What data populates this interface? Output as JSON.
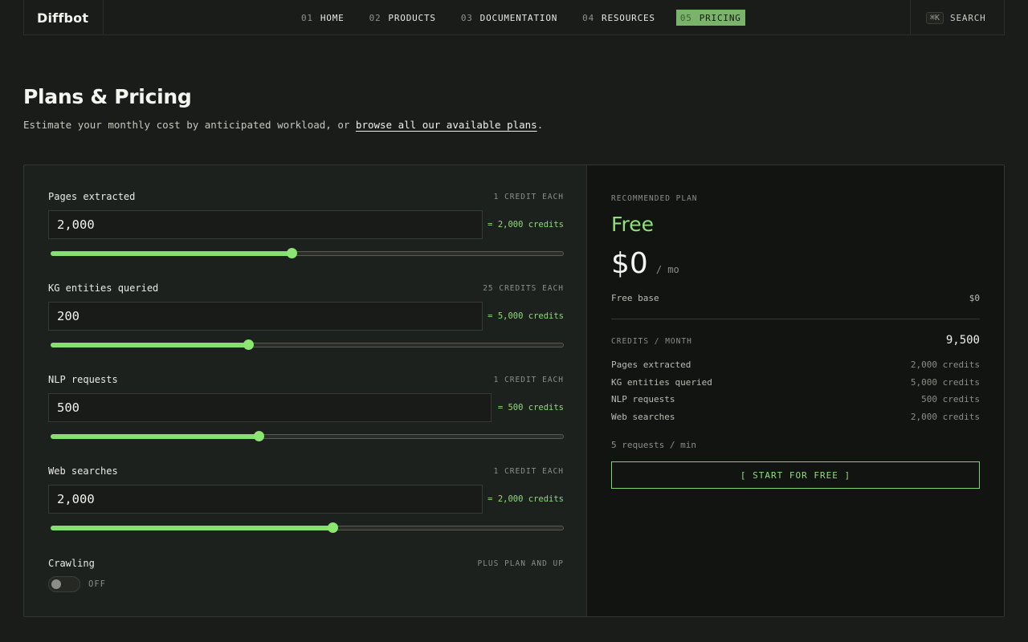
{
  "nav": {
    "logo": "Diffbot",
    "links": [
      {
        "num": "01",
        "label": "HOME"
      },
      {
        "num": "02",
        "label": "PRODUCTS"
      },
      {
        "num": "03",
        "label": "DOCUMENTATION"
      },
      {
        "num": "04",
        "label": "RESOURCES"
      },
      {
        "num": "05",
        "label": "PRICING"
      }
    ],
    "search_shortcut": "⌘K",
    "search_label": "SEARCH"
  },
  "header": {
    "title": "Plans & Pricing",
    "subtitle_prefix": "Estimate your monthly cost by anticipated workload, or ",
    "subtitle_link": "browse all our available plans",
    "subtitle_suffix": "."
  },
  "calculator": {
    "fields": [
      {
        "label": "Pages extracted",
        "rate": "1 CREDIT EACH",
        "value": "2,000",
        "credits": "= 2,000 credits",
        "slider_percent": 47
      },
      {
        "label": "KG entities queried",
        "rate": "25 CREDITS EACH",
        "value": "200",
        "credits": "= 5,000 credits",
        "slider_percent": 38.5
      },
      {
        "label": "NLP requests",
        "rate": "1 CREDIT EACH",
        "value": "500",
        "credits": "= 500 credits",
        "slider_percent": 40.5
      },
      {
        "label": "Web searches",
        "rate": "1 CREDIT EACH",
        "value": "2,000",
        "credits": "= 2,000 credits",
        "slider_percent": 55
      }
    ],
    "crawling": {
      "label": "Crawling",
      "note": "PLUS PLAN AND UP",
      "state": "OFF"
    }
  },
  "summary": {
    "recommended_label": "RECOMMENDED PLAN",
    "plan_name": "Free",
    "price": "$0",
    "per": "/ mo",
    "base_label": "Free base",
    "base_value": "$0",
    "credits_label": "CREDITS / MONTH",
    "credits_total": "9,500",
    "breakdown": [
      {
        "label": "Pages extracted",
        "value": "2,000 credits"
      },
      {
        "label": "KG entities queried",
        "value": "5,000 credits"
      },
      {
        "label": "NLP requests",
        "value": "500 credits"
      },
      {
        "label": "Web searches",
        "value": "2,000 credits"
      }
    ],
    "rate_limit": "5 requests / min",
    "cta": "[ START FOR FREE ]"
  },
  "colors": {
    "accent": "#86e06f",
    "background": "#1a1c19",
    "panel": "#121411"
  }
}
